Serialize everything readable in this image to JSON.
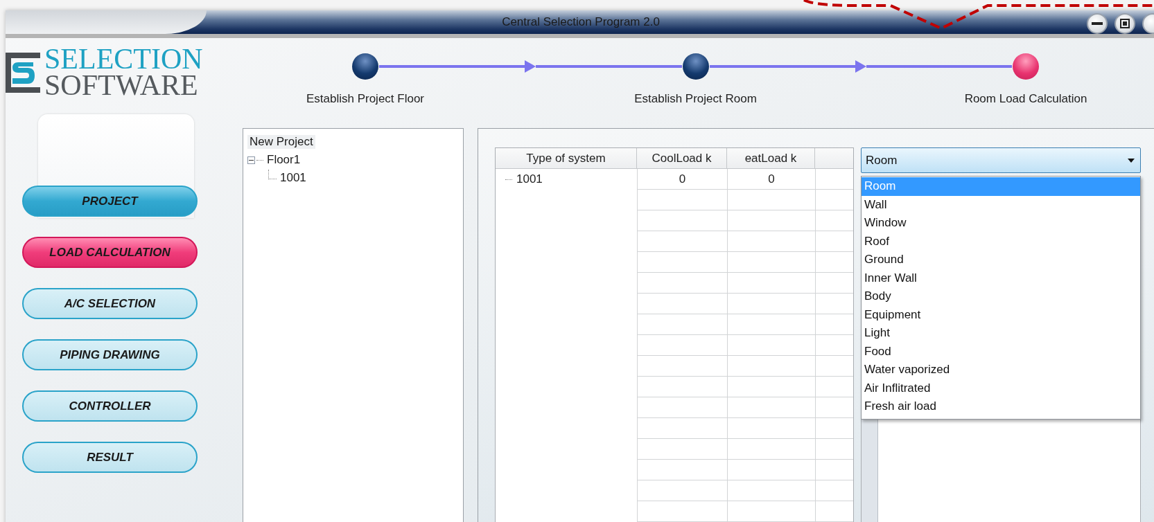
{
  "window": {
    "title": "Central Selection Program 2.0"
  },
  "logo": {
    "line_1": "SELECTION",
    "line_2": "SOFTWARE"
  },
  "steps": [
    {
      "label": "Establish Project Floor",
      "selected": false
    },
    {
      "label": "Establish Project Room",
      "selected": false
    },
    {
      "label": "Room Load Calculation",
      "selected": true
    }
  ],
  "nav": [
    {
      "label": "PROJECT",
      "selected": false,
      "visited": true
    },
    {
      "label": "LOAD CALCULATION",
      "selected": true,
      "visited": false
    },
    {
      "label": "A/C SELECTION",
      "selected": false,
      "visited": false
    },
    {
      "label": "PIPING DRAWING",
      "selected": false,
      "visited": false
    },
    {
      "label": "CONTROLLER",
      "selected": false,
      "visited": false
    },
    {
      "label": "RESULT",
      "selected": false,
      "visited": false
    }
  ],
  "tree": {
    "label": "New Project",
    "selected": true,
    "children": [
      {
        "label": "Floor1",
        "selected": false,
        "expanded": true,
        "children": [
          {
            "label": "1001",
            "selected": false
          }
        ]
      }
    ]
  },
  "table": {
    "columns": [
      "Type of system",
      "CoolLoad k",
      "eatLoad k"
    ],
    "rows": [
      {
        "name": "1001",
        "cool": "0",
        "heat": "0"
      }
    ]
  },
  "dropdown": {
    "value": "Room",
    "expanded": true,
    "options": [
      {
        "label": "Room",
        "selected": true
      },
      {
        "label": "Wall",
        "selected": false
      },
      {
        "label": "Window",
        "selected": false
      },
      {
        "label": "Roof",
        "selected": false
      },
      {
        "label": "Ground",
        "selected": false
      },
      {
        "label": "Inner Wall",
        "selected": false
      },
      {
        "label": "Body",
        "selected": false
      },
      {
        "label": "Equipment",
        "selected": false
      },
      {
        "label": "Light",
        "selected": false
      },
      {
        "label": "Food",
        "selected": false
      },
      {
        "label": "Water vaporized",
        "selected": false
      },
      {
        "label": "Air Inflitrated",
        "selected": false
      },
      {
        "label": "Fresh air load",
        "selected": false
      }
    ]
  }
}
